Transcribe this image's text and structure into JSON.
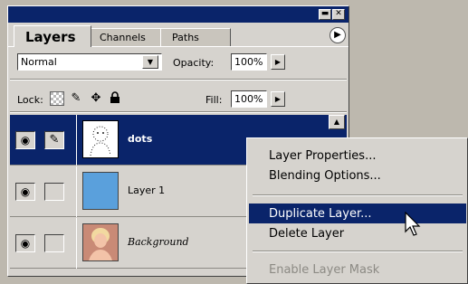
{
  "palette": {
    "tabs": [
      {
        "label": "Layers",
        "active": true
      },
      {
        "label": "Channels",
        "active": false
      },
      {
        "label": "Paths",
        "active": false
      }
    ],
    "blend_mode": "Normal",
    "opacity_label": "Opacity:",
    "opacity_value": "100%",
    "lock_label": "Lock:",
    "fill_label": "Fill:",
    "fill_value": "100%",
    "layers": [
      {
        "name": "dots",
        "selected": true
      },
      {
        "name": "Layer 1",
        "selected": false
      },
      {
        "name": "Background",
        "selected": false
      }
    ]
  },
  "context_menu": {
    "items": [
      {
        "label": "Layer Properties...",
        "enabled": true
      },
      {
        "label": "Blending Options...",
        "enabled": true
      },
      {
        "label": "Duplicate Layer...",
        "enabled": true,
        "highlighted": true
      },
      {
        "label": "Delete Layer",
        "enabled": true
      },
      {
        "label": "Enable Layer Mask",
        "enabled": false
      }
    ]
  },
  "colors": {
    "title_bar": "#0a246a",
    "selection": "#0a246a",
    "layer1_thumb": "#5aa0dc",
    "panel_bg": "#d6d3ce"
  },
  "icons": [
    "minimize-icon",
    "close-icon",
    "palette-menu-icon",
    "eye-icon",
    "paintbrush-icon",
    "lock-transparency-icon",
    "lock-move-icon",
    "lock-all-icon",
    "mouse-pointer-icon"
  ]
}
